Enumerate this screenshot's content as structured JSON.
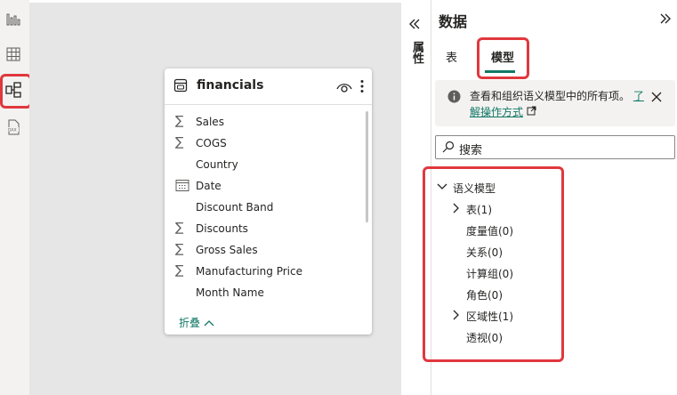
{
  "colors": {
    "accent": "#117865",
    "highlight": "#e0383e",
    "canvas": "#e6e6e6"
  },
  "rail": {
    "items": [
      {
        "name": "report-view",
        "icon": "bar-chart-icon"
      },
      {
        "name": "table-view",
        "icon": "grid-icon"
      },
      {
        "name": "model-view",
        "icon": "model-icon"
      },
      {
        "name": "dax-query-view",
        "icon": "dax-icon"
      }
    ]
  },
  "card": {
    "title": "financials",
    "fields": [
      {
        "label": "Sales",
        "sigma": "∑"
      },
      {
        "label": "COGS",
        "sigma": "∑"
      },
      {
        "label": "Country",
        "sigma": ""
      },
      {
        "label": "Date",
        "sigma": ""
      },
      {
        "label": "Discount Band",
        "sigma": ""
      },
      {
        "label": "Discounts",
        "sigma": "∑"
      },
      {
        "label": "Gross Sales",
        "sigma": "∑"
      },
      {
        "label": "Manufacturing Price",
        "sigma": "∑"
      },
      {
        "label": "Month Name",
        "sigma": ""
      }
    ],
    "collapse_label": "折叠"
  },
  "strip": {
    "label": "属性"
  },
  "pane": {
    "title": "数据",
    "tabs": {
      "table": "表",
      "model": "模型"
    },
    "info": {
      "text": "查看和组织语义模型中的所有项。",
      "link1": "了",
      "link2": "解操作方式"
    },
    "search": {
      "placeholder": "搜索"
    },
    "tree": {
      "root": "语义模型",
      "items": {
        "tables": "表(1)",
        "measures": "度量值(0)",
        "relationships": "关系(0)",
        "calc_groups": "计算组(0)",
        "roles": "角色(0)",
        "regions": "区域性(1)",
        "perspectives": "透视(0)"
      }
    }
  }
}
